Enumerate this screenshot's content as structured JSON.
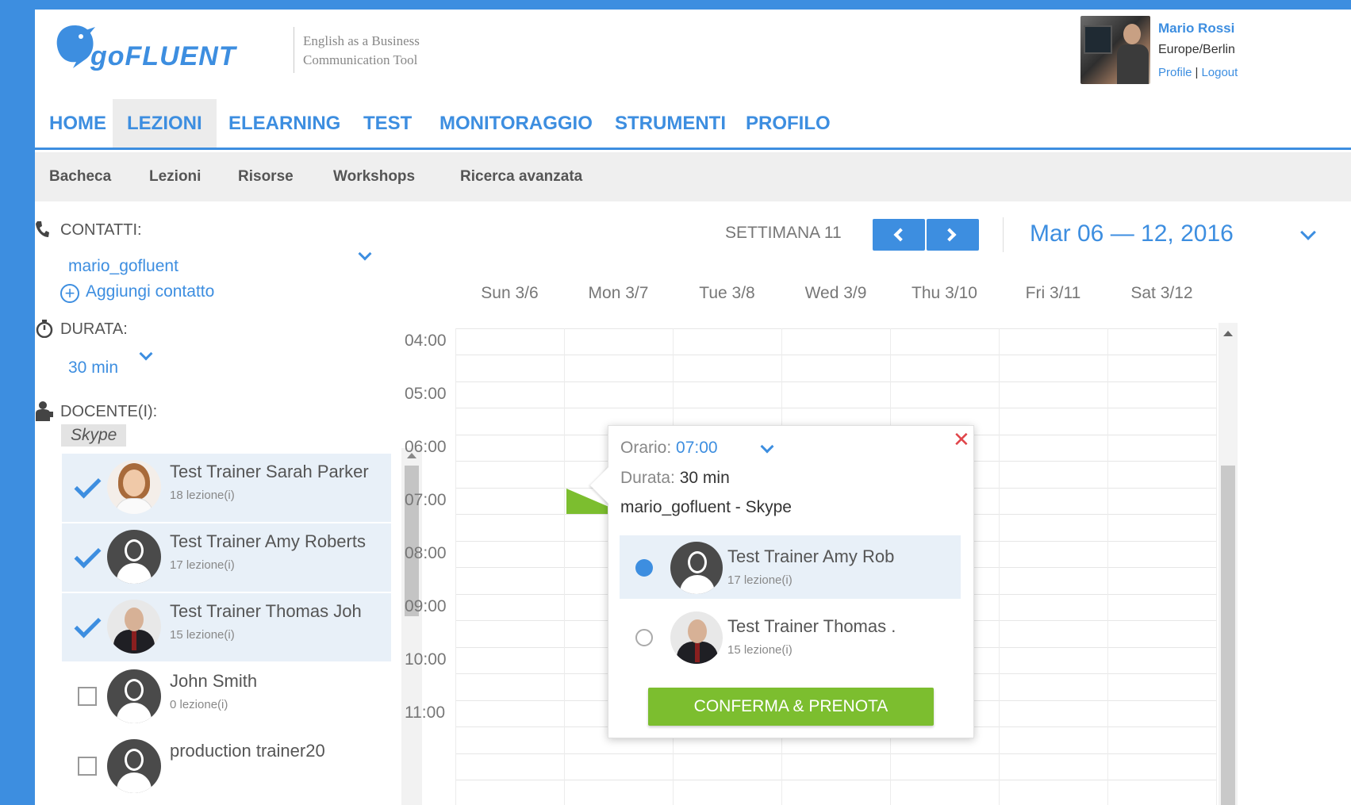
{
  "brand": {
    "logo_text": "goFLUENT",
    "tagline": "English as a Business Communication Tool",
    "accent_color": "#3d8ee0",
    "green_color": "#7cbe2f"
  },
  "user": {
    "name": "Mario Rossi",
    "timezone": "Europe/Berlin",
    "profile_link": "Profile",
    "separator": "|",
    "logout_link": "Logout"
  },
  "main_nav": {
    "items": [
      {
        "label": "HOME"
      },
      {
        "label": "LEZIONI",
        "active": true
      },
      {
        "label": "ELEARNING"
      },
      {
        "label": "TEST"
      },
      {
        "label": "MONITORAGGIO"
      },
      {
        "label": "STRUMENTI"
      },
      {
        "label": "PROFILO"
      }
    ]
  },
  "sub_nav": {
    "items": [
      {
        "label": "Bacheca"
      },
      {
        "label": "Lezioni"
      },
      {
        "label": "Risorse"
      },
      {
        "label": "Workshops"
      },
      {
        "label": "Ricerca avanzata"
      }
    ]
  },
  "filters": {
    "contacts_label": "CONTATTI:",
    "contact_value": "mario_gofluent",
    "add_contact": "Aggiungi contatto",
    "duration_label": "DURATA:",
    "duration_value": "30 min",
    "teachers_label": "DOCENTE(I):",
    "channel": "Skype"
  },
  "trainers": [
    {
      "name": "Test Trainer Sarah Parker",
      "lessons": "18 lezione(i)",
      "checked": true,
      "avatar": "woman"
    },
    {
      "name": "Test Trainer Amy Roberts",
      "lessons": "17 lezione(i)",
      "checked": true,
      "avatar": "generic"
    },
    {
      "name": "Test Trainer Thomas Joh",
      "lessons": "15 lezione(i)",
      "checked": true,
      "avatar": "man"
    },
    {
      "name": "John Smith",
      "lessons": "0 lezione(i)",
      "checked": false,
      "avatar": "generic"
    },
    {
      "name": "production trainer20",
      "lessons": "",
      "checked": false,
      "avatar": "generic"
    }
  ],
  "calendar": {
    "week_label": "SETTIMANA 11",
    "date_range": "Mar 06 — 12, 2016",
    "days": [
      "Sun 3/6",
      "Mon 3/7",
      "Tue 3/8",
      "Wed 3/9",
      "Thu 3/10",
      "Fri 3/11",
      "Sat 3/12"
    ],
    "times": [
      "04:00",
      "05:00",
      "06:00",
      "07:00",
      "08:00",
      "09:00",
      "10:00",
      "11:00"
    ]
  },
  "popover": {
    "time_label": "Orario:",
    "time_value": "07:00",
    "duration_label": "Durata:",
    "duration_value": "30 min",
    "contact": "mario_gofluent - Skype",
    "close": "✕",
    "trainers": [
      {
        "name": "Test Trainer Amy Rob",
        "lessons": "17 lezione(i)",
        "selected": true
      },
      {
        "name": "Test Trainer Thomas .",
        "lessons": "15 lezione(i)",
        "selected": false
      }
    ],
    "confirm": "CONFERMA & PRENOTA"
  }
}
